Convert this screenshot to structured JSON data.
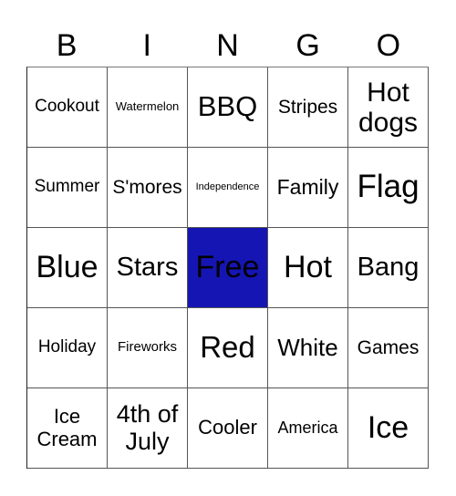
{
  "header": [
    "B",
    "I",
    "N",
    "G",
    "O"
  ],
  "free_color": "#1515b4",
  "cells": [
    {
      "text": "Cookout",
      "size": 19
    },
    {
      "text": "Watermelon",
      "size": 13
    },
    {
      "text": "BBQ",
      "size": 31
    },
    {
      "text": "Stripes",
      "size": 21
    },
    {
      "text": "Hot dogs",
      "size": 30
    },
    {
      "text": "Summer",
      "size": 19
    },
    {
      "text": "S'mores",
      "size": 21
    },
    {
      "text": "Independence",
      "size": 11
    },
    {
      "text": "Family",
      "size": 23
    },
    {
      "text": "Flag",
      "size": 35
    },
    {
      "text": "Blue",
      "size": 34
    },
    {
      "text": "Stars",
      "size": 29
    },
    {
      "text": "Free",
      "size": 34,
      "free": true
    },
    {
      "text": "Hot",
      "size": 34
    },
    {
      "text": "Bang",
      "size": 29
    },
    {
      "text": "Holiday",
      "size": 19
    },
    {
      "text": "Fireworks",
      "size": 15
    },
    {
      "text": "Red",
      "size": 33
    },
    {
      "text": "White",
      "size": 26
    },
    {
      "text": "Games",
      "size": 21
    },
    {
      "text": "Ice Cream",
      "size": 22
    },
    {
      "text": "4th of July",
      "size": 27
    },
    {
      "text": "Cooler",
      "size": 22
    },
    {
      "text": "America",
      "size": 18
    },
    {
      "text": "Ice",
      "size": 34
    }
  ]
}
